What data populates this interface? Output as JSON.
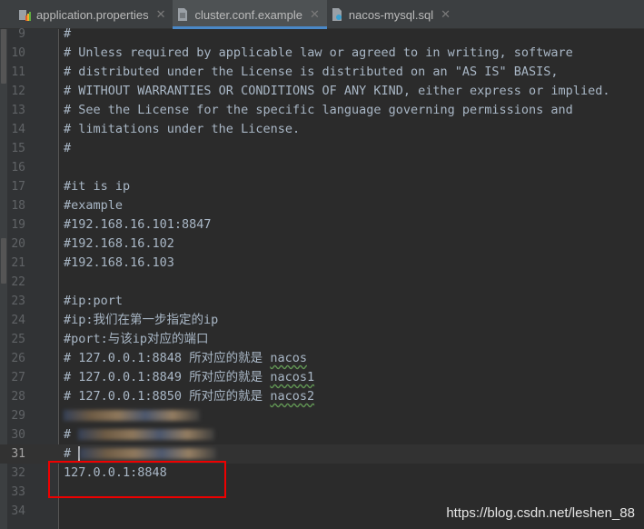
{
  "tabs": [
    {
      "label": "application.properties",
      "icon": "properties-file-icon",
      "active": false
    },
    {
      "label": "cluster.conf.example",
      "icon": "text-file-icon",
      "active": true
    },
    {
      "label": "nacos-mysql.sql",
      "icon": "sql-file-icon",
      "active": false
    }
  ],
  "close_glyph": "✕",
  "lines": [
    {
      "n": "9",
      "t": "#"
    },
    {
      "n": "10",
      "t": "# Unless required by applicable law or agreed to in writing, software"
    },
    {
      "n": "11",
      "t": "# distributed under the License is distributed on an \"AS IS\" BASIS,"
    },
    {
      "n": "12",
      "t": "# WITHOUT WARRANTIES OR CONDITIONS OF ANY KIND, either express or implied."
    },
    {
      "n": "13",
      "t": "# See the License for the specific language governing permissions and"
    },
    {
      "n": "14",
      "t": "# limitations under the License."
    },
    {
      "n": "15",
      "t": "#"
    },
    {
      "n": "16",
      "t": ""
    },
    {
      "n": "17",
      "t": "#it is ip"
    },
    {
      "n": "18",
      "t": "#example"
    },
    {
      "n": "19",
      "t": "#192.168.16.101:8847"
    },
    {
      "n": "20",
      "t": "#192.168.16.102"
    },
    {
      "n": "21",
      "t": "#192.168.16.103"
    },
    {
      "n": "22",
      "t": ""
    },
    {
      "n": "23",
      "t": "#ip:port"
    },
    {
      "n": "24",
      "t": "#ip:我们在第一步指定的ip"
    },
    {
      "n": "25",
      "t": "#port:与该ip对应的端口"
    },
    {
      "n": "26",
      "t": "# 127.0.0.1:8848 所对应的就是 ",
      "kw": "nacos"
    },
    {
      "n": "27",
      "t": "# 127.0.0.1:8849 所对应的就是 ",
      "kw": "nacos1"
    },
    {
      "n": "28",
      "t": "# 127.0.0.1:8850 所对应的就是 ",
      "kw": "nacos2"
    },
    {
      "n": "29",
      "t": "",
      "blurred": true
    },
    {
      "n": "30",
      "t": "# ",
      "blurred": true
    },
    {
      "n": "31",
      "t": "# ",
      "blurred": true,
      "current": true
    },
    {
      "n": "32",
      "t": "127.0.0.1:8848"
    },
    {
      "n": "33",
      "t": ""
    },
    {
      "n": "34",
      "t": ""
    }
  ],
  "watermark": "https://blog.csdn.net/leshen_88"
}
